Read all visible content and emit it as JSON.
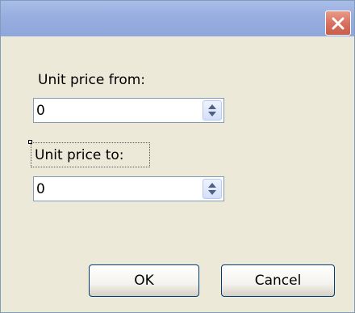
{
  "dialog": {
    "close_icon": "close-icon",
    "from": {
      "label": "Unit price from:",
      "value": "0",
      "spinner_icon": "up-down-arrows-icon"
    },
    "to": {
      "label": "Unit price to:",
      "value": "0",
      "spinner_icon": "up-down-arrows-icon"
    },
    "ok_label": "OK",
    "cancel_label": "Cancel"
  },
  "colors": {
    "titlebar": "#98aee0",
    "close_button": "#d77360",
    "background": "#ece9d8"
  }
}
